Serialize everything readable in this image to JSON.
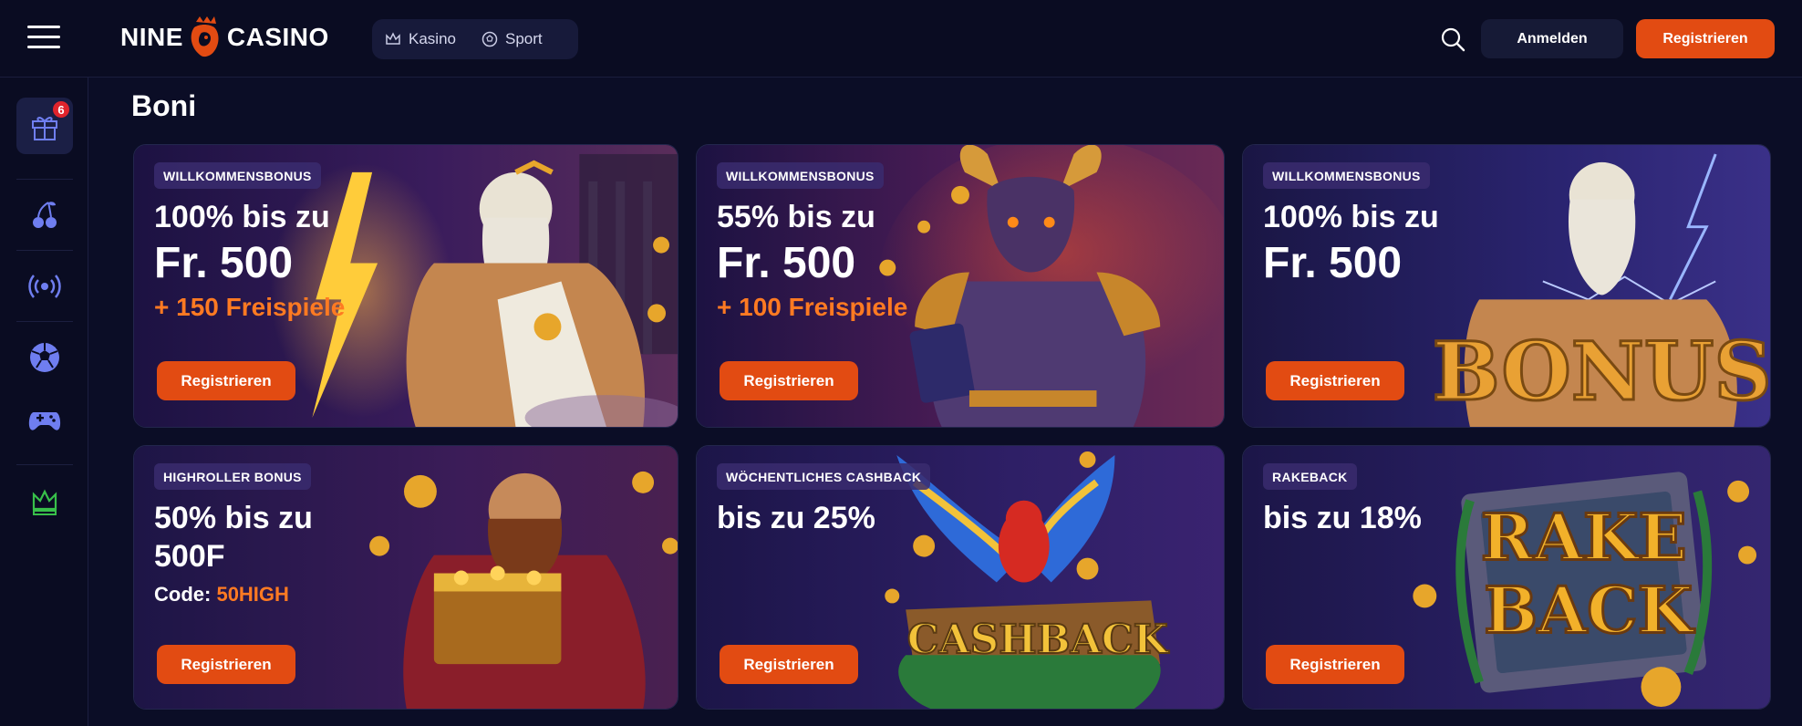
{
  "brand": {
    "name_left": "NINE",
    "name_right": "CASINO",
    "accent": "#e24b12"
  },
  "topnav": {
    "items": [
      {
        "label": "Kasino",
        "icon": "crown-icon"
      },
      {
        "label": "Sport",
        "icon": "soccer-ball-icon"
      }
    ]
  },
  "header": {
    "login_label": "Anmelden",
    "register_label": "Registrieren"
  },
  "sidebar": {
    "items": [
      {
        "icon": "gift-icon",
        "badge": "6"
      },
      {
        "icon": "cherries-icon"
      },
      {
        "icon": "live-broadcast-icon"
      },
      {
        "icon": "soccer-ball-icon"
      },
      {
        "icon": "gamepad-icon"
      },
      {
        "icon": "crown-icon"
      }
    ]
  },
  "page": {
    "title": "Boni"
  },
  "cards": [
    {
      "label": "WILLKOMMENSBONUS",
      "line1": "100% bis zu",
      "line2": "Fr. 500",
      "line3": "+ 150 Freispiele",
      "button": "Registrieren"
    },
    {
      "label": "WILLKOMMENSBONUS",
      "line1": "55% bis zu",
      "line2": "Fr. 500",
      "line3": "+ 100 Freispiele",
      "button": "Registrieren"
    },
    {
      "label": "WILLKOMMENSBONUS",
      "line1": "100% bis zu",
      "line2": "Fr. 500",
      "button": "Registrieren",
      "art_text": "BONUS"
    },
    {
      "label": "HIGHROLLER BONUS",
      "line1": "50% bis zu",
      "line1b": "500F",
      "code_label": "Code:",
      "code_value": "50HIGH",
      "button": "Registrieren"
    },
    {
      "label": "WÖCHENTLICHES CASHBACK",
      "line1": "bis zu 25%",
      "button": "Registrieren",
      "art_text": "CASHBACK"
    },
    {
      "label": "RAKEBACK",
      "line1": "bis zu 18%",
      "button": "Registrieren",
      "art_text_1": "RAKE",
      "art_text_2": "BACK"
    }
  ]
}
